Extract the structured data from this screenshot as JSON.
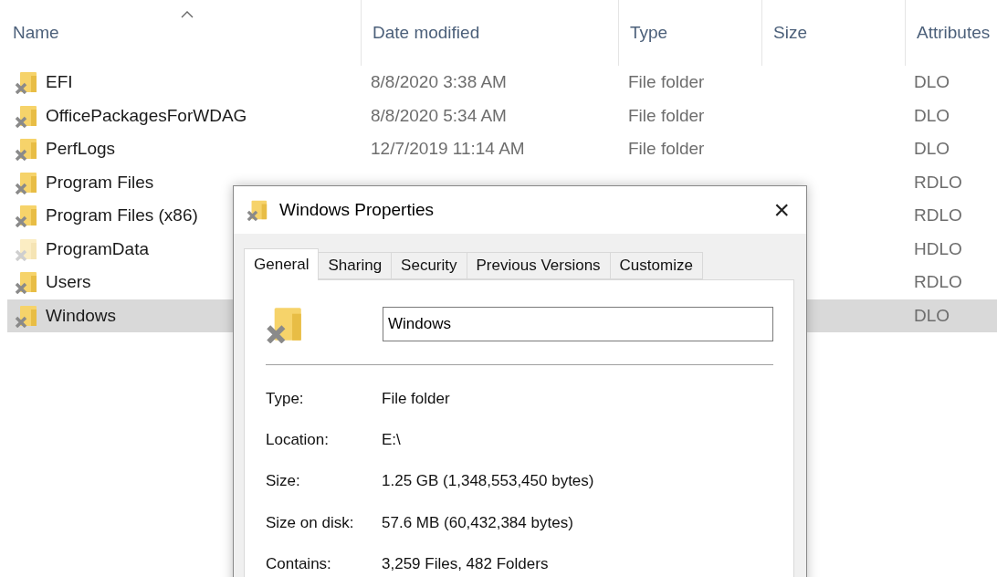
{
  "table": {
    "columns": [
      {
        "label": "Name",
        "sorted": true
      },
      {
        "label": "Date modified",
        "sorted": false
      },
      {
        "label": "Type",
        "sorted": false
      },
      {
        "label": "Size",
        "sorted": false
      },
      {
        "label": "Attributes",
        "sorted": false
      }
    ],
    "rows": [
      {
        "name": "EFI",
        "date": "8/8/2020 3:38 AM",
        "type": "File folder",
        "attributes": "DLO",
        "hidden": false,
        "selected": false
      },
      {
        "name": "OfficePackagesForWDAG",
        "date": "8/8/2020 5:34 AM",
        "type": "File folder",
        "attributes": "DLO",
        "hidden": false,
        "selected": false
      },
      {
        "name": "PerfLogs",
        "date": "12/7/2019 11:14 AM",
        "type": "File folder",
        "attributes": "DLO",
        "hidden": false,
        "selected": false
      },
      {
        "name": "Program Files",
        "attributes": "RDLO",
        "hidden": false,
        "selected": false
      },
      {
        "name": "Program Files (x86)",
        "attributes": "RDLO",
        "hidden": false,
        "selected": false
      },
      {
        "name": "ProgramData",
        "attributes": "HDLO",
        "hidden": true,
        "selected": false
      },
      {
        "name": "Users",
        "attributes": "RDLO",
        "hidden": false,
        "selected": false
      },
      {
        "name": "Windows",
        "attributes": "DLO",
        "hidden": false,
        "selected": true
      }
    ]
  },
  "dialog": {
    "title": "Windows Properties",
    "close": "×",
    "tabs": [
      {
        "label": "General",
        "selected": true
      },
      {
        "label": "Sharing",
        "selected": false
      },
      {
        "label": "Security",
        "selected": false
      },
      {
        "label": "Previous Versions",
        "selected": false
      },
      {
        "label": "Customize",
        "selected": false
      }
    ],
    "name_value": "Windows",
    "properties": [
      {
        "label": "Type:",
        "value": "File folder"
      },
      {
        "label": "Location:",
        "value": "E:\\"
      },
      {
        "label": "Size:",
        "value": "1.25 GB (1,348,553,450 bytes)"
      },
      {
        "label": "Size on disk:",
        "value": "57.6 MB (60,432,384 bytes)"
      },
      {
        "label": "Contains:",
        "value": "3,259 Files, 482 Folders"
      }
    ]
  }
}
